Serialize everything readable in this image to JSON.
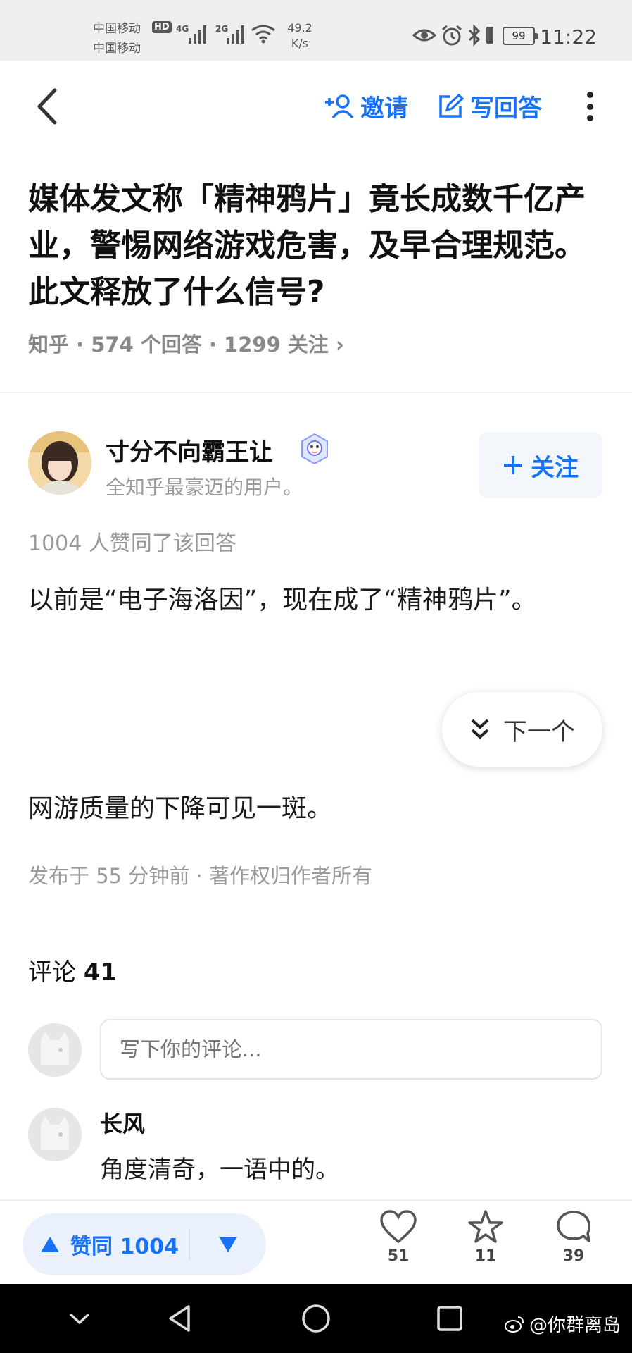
{
  "status_bar": {
    "carrier_1": "中国移动",
    "carrier_2": "中国移动",
    "hd": "HD",
    "net_1": "4G",
    "net_2": "2G",
    "speed_value": "49.2",
    "speed_unit": "K/s",
    "battery": "99",
    "time": "11:22"
  },
  "nav": {
    "invite_label": "邀请",
    "write_answer_label": "写回答"
  },
  "question": {
    "title": "媒体发文称「精神鸦片」竟长成数千亿产业，警惕网络游戏危害，及早合理规范。此文释放了什么信号?",
    "meta": "知乎 · 574 个回答 · 1299 关注 ›"
  },
  "answer": {
    "author_name": "寸分不向霸王让",
    "author_bio": "全知乎最豪迈的用户。",
    "follow_label": "关注",
    "upvote_summary": "1004 人赞同了该回答",
    "paragraph_1": "以前是“电子海洛因”，现在成了“精神鸦片”。",
    "paragraph_2": "网游质量的下降可见一斑。",
    "next_label": "下一个",
    "publish_info": "发布于 55 分钟前 · 著作权归作者所有"
  },
  "comments": {
    "heading_label": "评论",
    "count": "41",
    "input_placeholder": "写下你的评论...",
    "first_author": "长风",
    "first_text": "角度清奇，一语中的。"
  },
  "action_bar": {
    "upvote_label": "赞同 1004",
    "like_count": "51",
    "favorite_count": "11",
    "comment_count": "39"
  },
  "watermark": "@你群离岛",
  "colors": {
    "accent": "#1772f6",
    "muted": "#999999",
    "status_bar_bg": "#efefef"
  }
}
